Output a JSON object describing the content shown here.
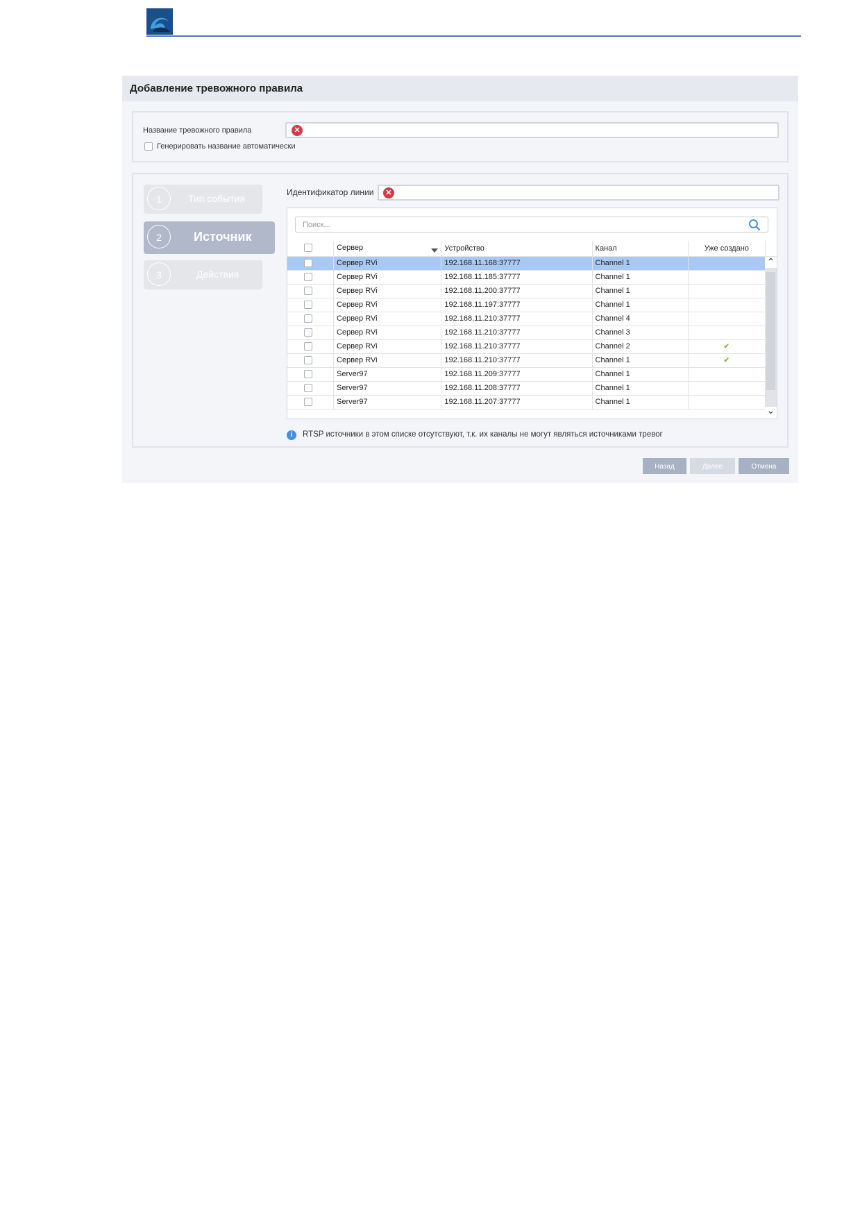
{
  "header": {
    "logo_colors": {
      "bg": "#1b4f8a",
      "accent": "#3ea0dd"
    },
    "rule_color": "#4d79b8"
  },
  "dialog": {
    "title": "Добавление тревожного правила",
    "rule_name": {
      "label": "Название тревожного правила",
      "value": "",
      "error_icon": "error-x-icon"
    },
    "auto_name": {
      "label": "Генерировать название автоматически",
      "checked": false
    },
    "steps": [
      {
        "num": "1",
        "label": "Тип события",
        "state": "done"
      },
      {
        "num": "2",
        "label": "Источник",
        "state": "active"
      },
      {
        "num": "3",
        "label": "Действия",
        "state": "pending"
      }
    ],
    "line_id": {
      "label": "Идентификатор линии",
      "value": ""
    },
    "search": {
      "placeholder": "Поиск..."
    },
    "table": {
      "columns": [
        "Сервер",
        "Устройство",
        "Канал",
        "Уже создано"
      ],
      "rows": [
        {
          "server": "Сервер RVi",
          "device": "192.168.11.168:37777",
          "channel": "Channel 1",
          "created": false,
          "selected": true
        },
        {
          "server": "Сервер RVi",
          "device": "192.168.11.185:37777",
          "channel": "Channel 1",
          "created": false,
          "selected": false
        },
        {
          "server": "Сервер RVi",
          "device": "192.168.11.200:37777",
          "channel": "Channel 1",
          "created": false,
          "selected": false
        },
        {
          "server": "Сервер RVi",
          "device": "192.168.11.197:37777",
          "channel": "Channel 1",
          "created": false,
          "selected": false
        },
        {
          "server": "Сервер RVi",
          "device": "192.168.11.210:37777",
          "channel": "Channel 4",
          "created": false,
          "selected": false
        },
        {
          "server": "Сервер RVi",
          "device": "192.168.11.210:37777",
          "channel": "Channel 3",
          "created": false,
          "selected": false
        },
        {
          "server": "Сервер RVi",
          "device": "192.168.11.210:37777",
          "channel": "Channel 2",
          "created": true,
          "selected": false
        },
        {
          "server": "Сервер RVi",
          "device": "192.168.11.210:37777",
          "channel": "Channel 1",
          "created": true,
          "selected": false
        },
        {
          "server": "Server97",
          "device": "192.168.11.209:37777",
          "channel": "Channel 1",
          "created": false,
          "selected": false
        },
        {
          "server": "Server97",
          "device": "192.168.11.208:37777",
          "channel": "Channel 1",
          "created": false,
          "selected": false
        },
        {
          "server": "Server97",
          "device": "192.168.11.207:37777",
          "channel": "Channel 1",
          "created": false,
          "selected": false
        }
      ]
    },
    "info": "RTSP источники в этом списке отсутствуют, т.к. их каналы не могут являться источниками тревог",
    "buttons": {
      "back": "Назад",
      "next": "Далее",
      "cancel": "Отмена"
    },
    "colors": {
      "selected_row": "#a9c8f2",
      "error": "#d43a48",
      "check": "#7db84b",
      "info": "#4a8fdd"
    }
  }
}
